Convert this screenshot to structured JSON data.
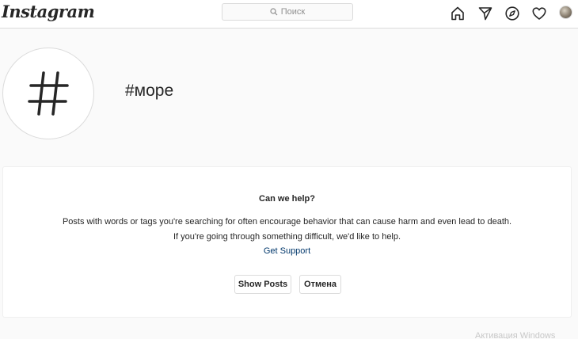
{
  "header": {
    "logo": "Instagram",
    "search_placeholder": "Поиск",
    "nav_icons": [
      "home-icon",
      "direct-icon",
      "explore-icon",
      "activity-icon",
      "profile-avatar"
    ]
  },
  "hashtag": {
    "symbol": "#",
    "title": "#море"
  },
  "help": {
    "title": "Can we help?",
    "line1": "Posts with words or tags you're searching for often encourage behavior that can cause harm and even lead to death.",
    "line2": "If you're going through something difficult, we'd like to help.",
    "support_link": "Get Support",
    "show_posts_label": "Show Posts",
    "cancel_label": "Отмена"
  },
  "watermark": "Активация Windows",
  "colors": {
    "link": "#00376b",
    "border": "#dbdbdb",
    "background": "#fafafa"
  }
}
